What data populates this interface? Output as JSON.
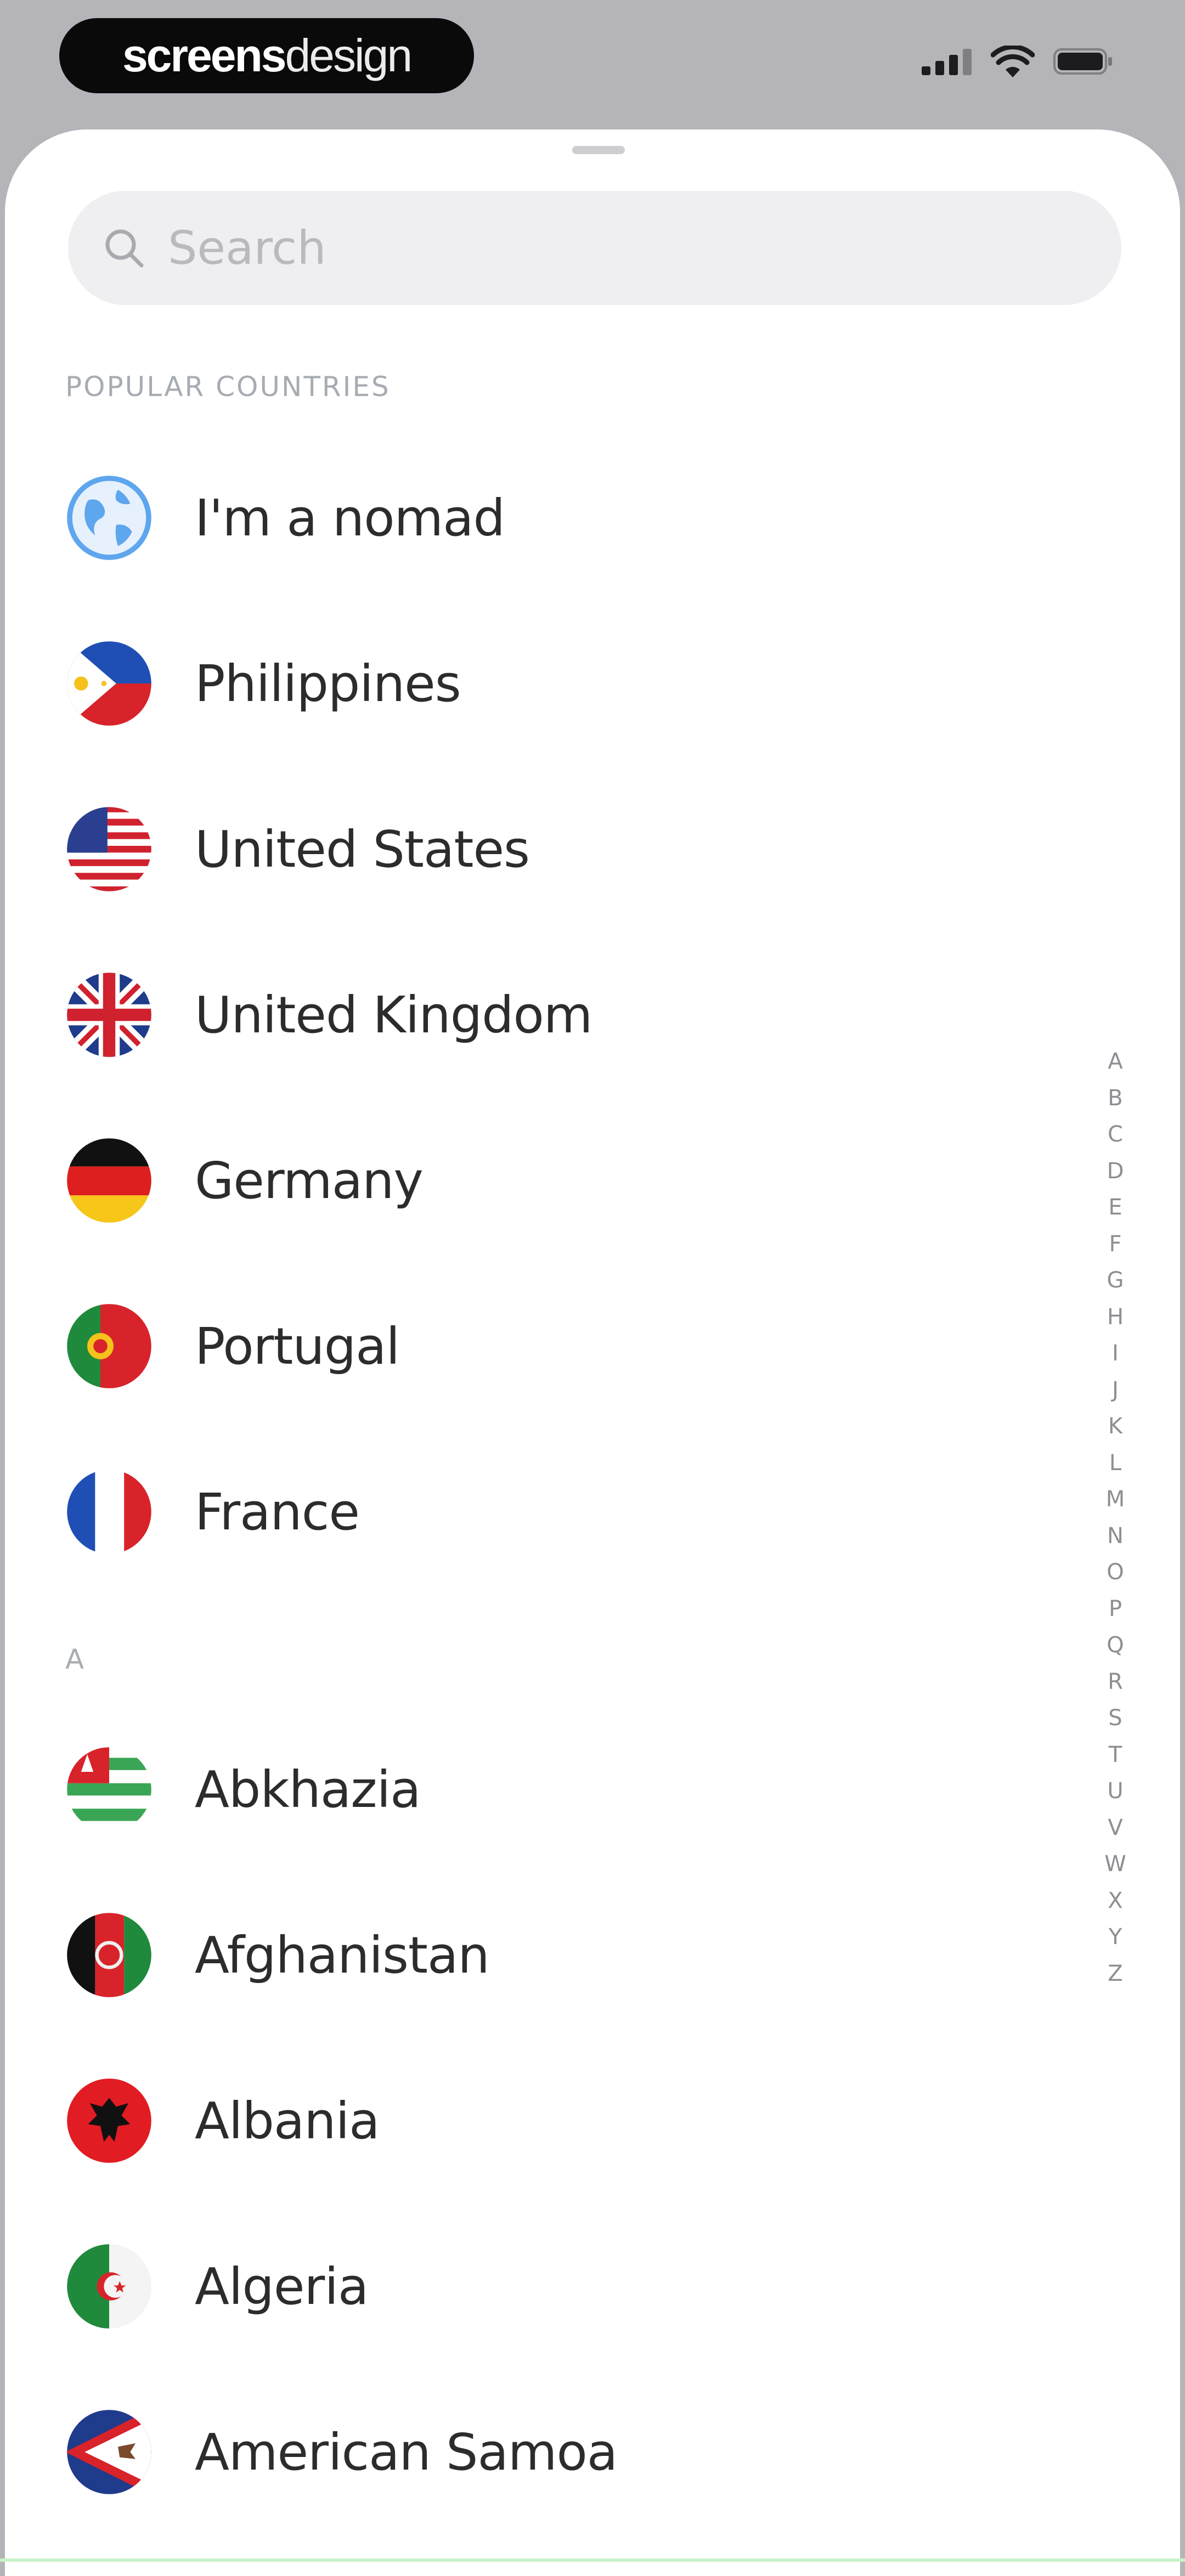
{
  "status_bar": {
    "brand": {
      "part_a": "screens",
      "part_b": "design"
    },
    "icons": [
      "cellular-signal-icon",
      "wifi-icon",
      "battery-icon"
    ]
  },
  "search": {
    "placeholder": "Search",
    "value": ""
  },
  "popular": {
    "header": "POPULAR COUNTRIES",
    "items": [
      {
        "label": "I'm a nomad",
        "flag": "globe"
      },
      {
        "label": "Philippines",
        "flag": "philippines"
      },
      {
        "label": "United States",
        "flag": "united-states"
      },
      {
        "label": "United Kingdom",
        "flag": "united-kingdom"
      },
      {
        "label": "Germany",
        "flag": "germany"
      },
      {
        "label": "Portugal",
        "flag": "portugal"
      },
      {
        "label": "France",
        "flag": "france"
      }
    ]
  },
  "section_a": {
    "header": "A",
    "items": [
      {
        "label": "Abkhazia",
        "flag": "abkhazia"
      },
      {
        "label": "Afghanistan",
        "flag": "afghanistan"
      },
      {
        "label": "Albania",
        "flag": "albania"
      },
      {
        "label": "Algeria",
        "flag": "algeria"
      },
      {
        "label": "American Samoa",
        "flag": "american-samoa"
      }
    ]
  },
  "alphabet_index": [
    "A",
    "B",
    "C",
    "D",
    "E",
    "F",
    "G",
    "H",
    "I",
    "J",
    "K",
    "L",
    "M",
    "N",
    "O",
    "P",
    "Q",
    "R",
    "S",
    "T",
    "U",
    "V",
    "W",
    "X",
    "Y",
    "Z"
  ],
  "colors": {
    "sheet_background": "#ffffff",
    "backdrop": "#b4b4b9",
    "search_fill": "#efeff1",
    "label_text": "#2c2c2e",
    "section_header_text": "#a7acb3",
    "index_text": "#8e8e93"
  }
}
